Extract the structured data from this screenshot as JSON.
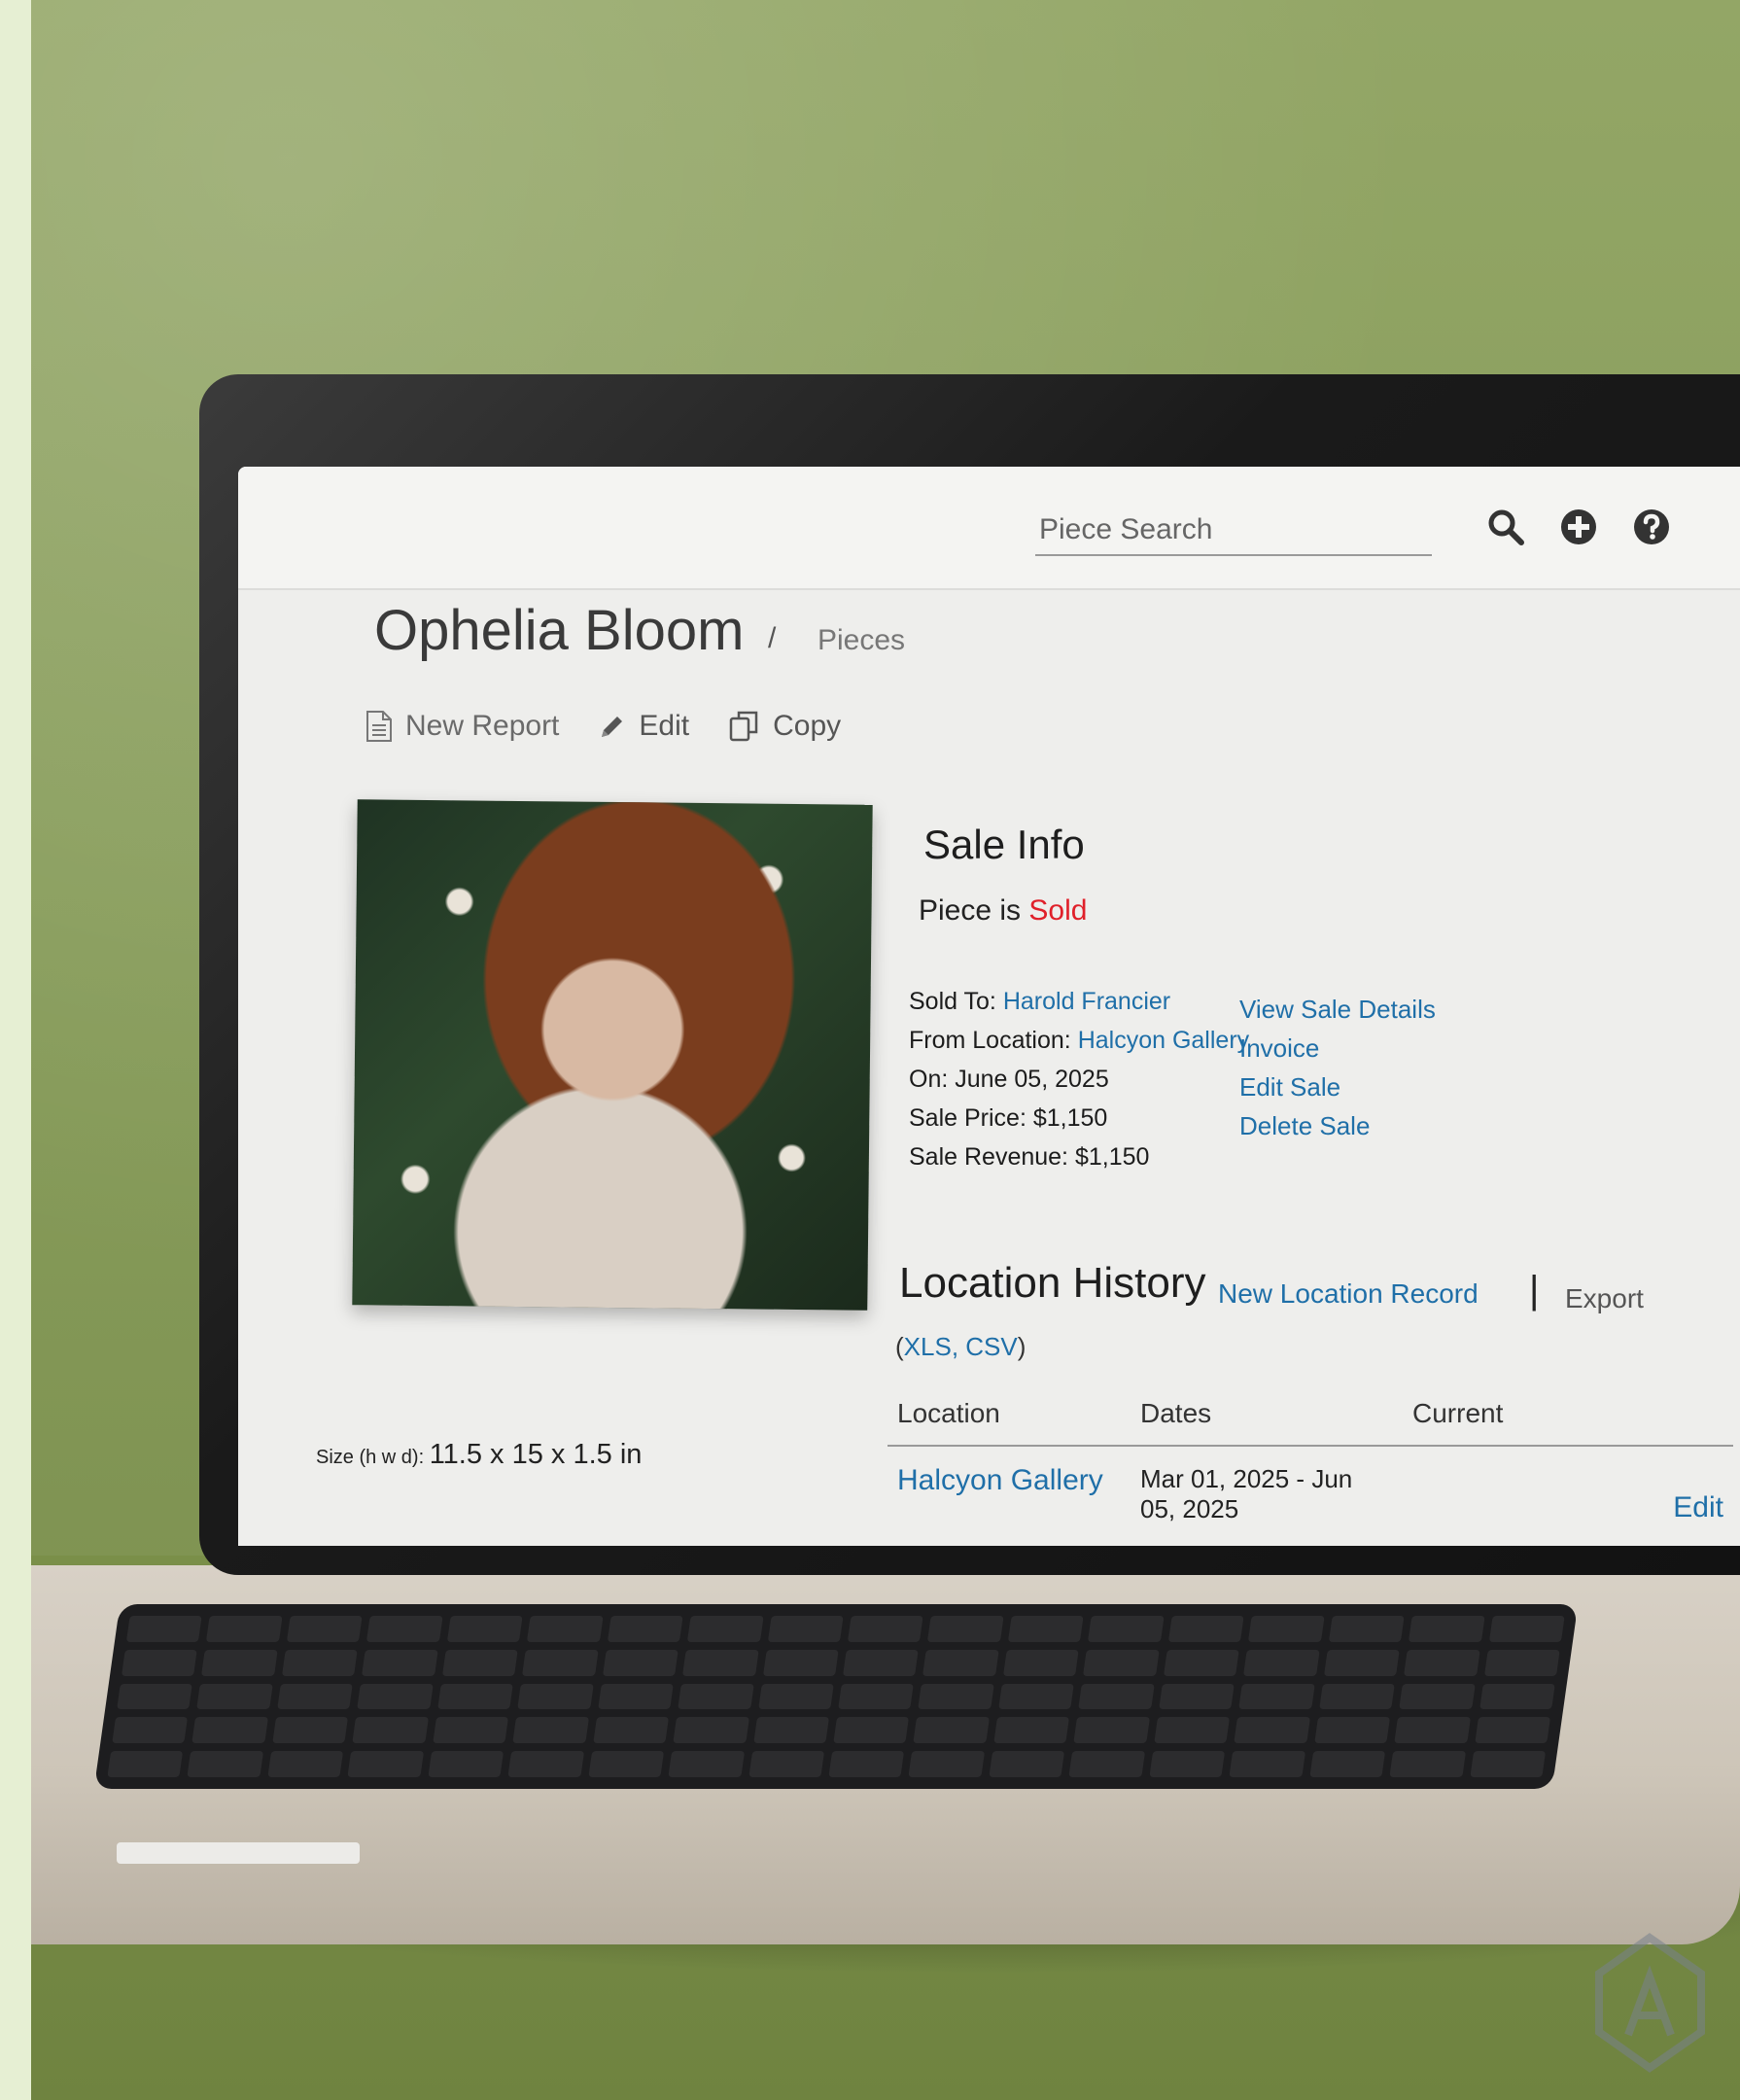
{
  "topbar": {
    "search_placeholder": "Piece Search",
    "icons": [
      "search-icon",
      "add-icon",
      "help-icon"
    ]
  },
  "header": {
    "title": "Ophelia Bloom",
    "separator": "/",
    "breadcrumb": "Pieces"
  },
  "toolbar": {
    "new_report": "New Report",
    "edit": "Edit",
    "copy": "Copy"
  },
  "sale_info": {
    "title": "Sale Info",
    "status_prefix": "Piece is ",
    "status": "Sold",
    "sold_to_label": "Sold To: ",
    "sold_to": "Harold Francier",
    "from_location_label": "From Location: ",
    "from_location": "Halcyon Gallery",
    "on_label": "On: ",
    "on_date": "June 05, 2025",
    "sale_price_label": "Sale Price: ",
    "sale_price": "$1,150",
    "sale_revenue_label": "Sale Revenue: ",
    "sale_revenue": "$1,150",
    "actions": {
      "view_details": "View Sale Details",
      "invoice": "Invoice",
      "edit_sale": "Edit Sale",
      "delete_sale": "Delete Sale"
    }
  },
  "location_history": {
    "title": "Location History",
    "new_record": "New Location Record",
    "separator": "|",
    "export_label": "Export",
    "formats_open": "(",
    "format_xls": "XLS",
    "format_sep": ", ",
    "format_csv": "CSV",
    "formats_close": ")",
    "columns": {
      "location": "Location",
      "dates": "Dates",
      "current": "Current"
    },
    "rows": [
      {
        "location": "Halcyon Gallery",
        "dates": "Mar 01, 2025 - Jun 05, 2025",
        "current": "",
        "edit": "Edit"
      }
    ]
  },
  "piece_details": {
    "size_label": "Size (h w d): ",
    "size_value": "11.5 x 15 x 1.5 in"
  },
  "colors": {
    "link": "#1f6fa8",
    "sold": "#e0202a",
    "screen_bg": "#eeeeec"
  }
}
